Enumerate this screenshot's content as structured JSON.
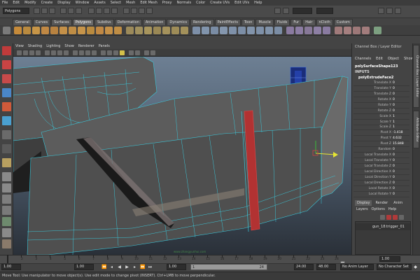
{
  "menubar": [
    "File",
    "Edit",
    "Modify",
    "Create",
    "Display",
    "Window",
    "Assets",
    "Select",
    "Mesh",
    "Edit Mesh",
    "Proxy",
    "Normals",
    "Color",
    "Create UVs",
    "Edit UVs",
    "Help"
  ],
  "statusline": {
    "mode": "Polygons"
  },
  "shelf_tabs": [
    "General",
    "Curves",
    "Surfaces",
    "Polygons",
    "Subdivs",
    "Deformation",
    "Animation",
    "Dynamics",
    "Rendering",
    "PaintEffects",
    "Toon",
    "Muscle",
    "Fluids",
    "Fur",
    "Hair",
    "nCloth",
    "Custom"
  ],
  "shelf_active_tab": "Polygons",
  "viewport_menu": [
    "View",
    "Shading",
    "Lighting",
    "Show",
    "Renderer",
    "Panels"
  ],
  "watermark": "www.zhangyunhui.com",
  "channel_box": {
    "title": "Channel Box / Layer Editor",
    "menu": [
      "Channels",
      "Edit",
      "Object",
      "Show"
    ],
    "shape": "polySurfaceShape123",
    "inputs_label": "INPUTS",
    "node": "polyExtrudeFace2",
    "attributes": [
      {
        "name": "Translate X",
        "value": "0"
      },
      {
        "name": "Translate Y",
        "value": "0"
      },
      {
        "name": "Translate Z",
        "value": "0"
      },
      {
        "name": "Rotate X",
        "value": "0"
      },
      {
        "name": "Rotate Y",
        "value": "0"
      },
      {
        "name": "Rotate Z",
        "value": "0"
      },
      {
        "name": "Scale X",
        "value": "1"
      },
      {
        "name": "Scale Y",
        "value": "1"
      },
      {
        "name": "Scale Z",
        "value": "1"
      },
      {
        "name": "Pivot X",
        "value": "-1.418"
      },
      {
        "name": "Pivot Y",
        "value": "4.632"
      },
      {
        "name": "Pivot Z",
        "value": "15.848"
      },
      {
        "name": "Random",
        "value": "0"
      },
      {
        "name": "Local Translate X",
        "value": "0"
      },
      {
        "name": "Local Translate Y",
        "value": "0"
      },
      {
        "name": "Local Translate Z",
        "value": "0"
      },
      {
        "name": "Local Direction X",
        "value": "0"
      },
      {
        "name": "Local Direction Y",
        "value": "0"
      },
      {
        "name": "Local Direction Z",
        "value": "0"
      },
      {
        "name": "Local Rotate X",
        "value": "0"
      },
      {
        "name": "Local Rotate Y",
        "value": "0"
      }
    ]
  },
  "layer_editor": {
    "tabs": [
      "Display",
      "Render",
      "Anim"
    ],
    "menu": [
      "Layers",
      "Options",
      "Help"
    ],
    "layer_name": "gun_18:trigger_01"
  },
  "side_tabs": [
    "Channel Box / Layer Editor",
    "Attribute Editor"
  ],
  "timeslider": {
    "ticks": [
      "1",
      "2",
      "3",
      "4",
      "5",
      "6",
      "7",
      "8",
      "9",
      "10",
      "11",
      "12",
      "13",
      "14",
      "15",
      "16",
      "17",
      "18",
      "19",
      "20",
      "21",
      "22",
      "23",
      "24"
    ],
    "current": "1.00"
  },
  "range": {
    "start": "1.00",
    "range_start": "1.00",
    "range_mid": "1",
    "range_end": "24",
    "end": "24.00",
    "end2": "48.00",
    "anim_layer": "No Anim Layer",
    "character_set": "No Character Set"
  },
  "help_text": "Move Tool: Use manipulator to move object(s). Use edit mode to change pivot (INSERT). Ctrl+LMB to move perpendicular."
}
